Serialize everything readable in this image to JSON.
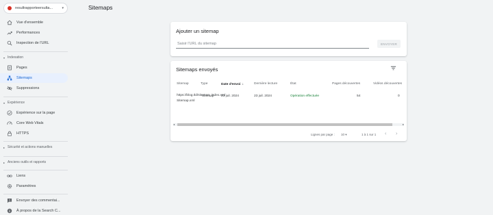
{
  "property": {
    "name": "resultrapporteersulta...",
    "caret": "▾"
  },
  "sidebar": {
    "top_items": [
      {
        "label": "Vue d'ensemble",
        "icon": "home-icon"
      },
      {
        "label": "Performances",
        "icon": "trending-up-icon"
      },
      {
        "label": "Inspection de l'URL",
        "icon": "search-icon"
      }
    ],
    "indexation": {
      "header": "Indexation",
      "items": [
        {
          "label": "Pages",
          "icon": "pages-icon"
        },
        {
          "label": "Sitemaps",
          "icon": "sitemap-icon",
          "active": true
        },
        {
          "label": "Suppressions",
          "icon": "eye-off-icon"
        }
      ]
    },
    "experience": {
      "header": "Expérience",
      "items": [
        {
          "label": "Expérience sur la page",
          "icon": "page-experience-icon"
        },
        {
          "label": "Core Web Vitals",
          "icon": "speed-icon"
        },
        {
          "label": "HTTPS",
          "icon": "lock-icon"
        }
      ]
    },
    "security_header": "Sécurité et actions manuelles",
    "legacy_header": "Anciens outils et rapports",
    "bottom_items": [
      {
        "label": "Liens",
        "icon": "links-icon"
      },
      {
        "label": "Paramètres",
        "icon": "gear-icon"
      },
      {
        "label": "Envoyer des commentai...",
        "icon": "feedback-icon"
      },
      {
        "label": "À propos de la Search C...",
        "icon": "info-icon"
      }
    ]
  },
  "header": {
    "title": "Sitemaps"
  },
  "add_sitemap": {
    "title": "Ajouter un sitemap",
    "placeholder": "Saisir l'URL du sitemap",
    "submit_label": "ENVOYER"
  },
  "submitted": {
    "title": "Sitemaps envoyés",
    "columns": {
      "sitemap": "Sitemap",
      "type": "Type",
      "submitted": "Date d'envoi",
      "last_read": "Dernière lecture",
      "status": "État",
      "pages": "Pages découvertes",
      "videos": "Vidéos découvertes"
    },
    "sort_arrow": "↓",
    "rows": [
      {
        "sitemap": "https://blog.tld/sitemap_index.xml Sitemap.xml",
        "type": "Sitemap",
        "submitted": "23 juil. 2024",
        "last_read": "23 juil. 2024",
        "status": "Opération effectuée",
        "pages": "54",
        "videos": "0"
      }
    ],
    "footer": {
      "rows_per_page_label": "Lignes par page :",
      "rows_per_page_value": "10",
      "range": "1 à 1 sur 1"
    }
  },
  "colors": {
    "accent": "#1967d2",
    "active_bg": "#e8f0fe",
    "status_ok": "#188038",
    "favicon": "#d93025"
  }
}
